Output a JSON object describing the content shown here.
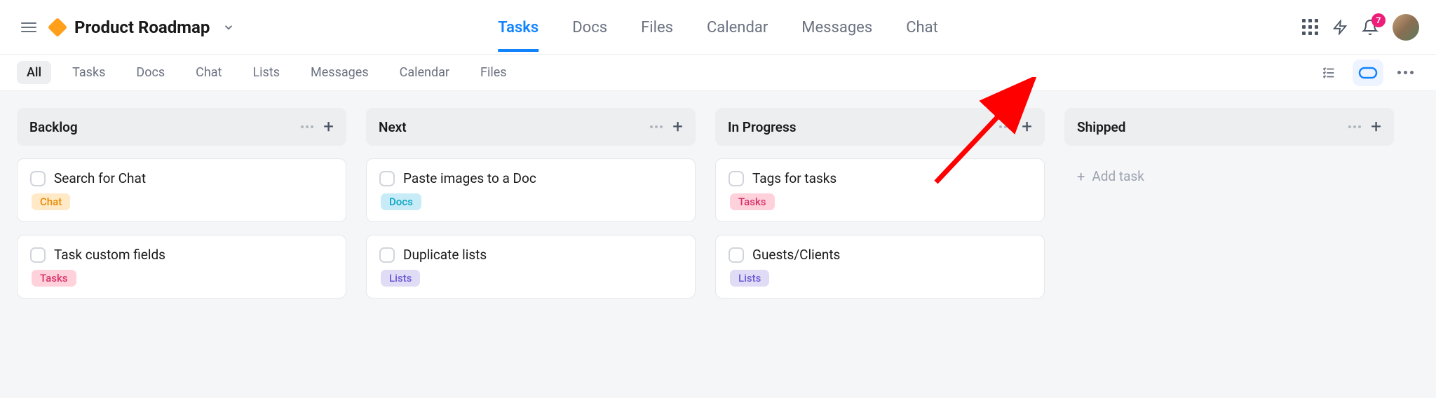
{
  "header": {
    "project_title": "Product Roadmap",
    "nav": [
      "Tasks",
      "Docs",
      "Files",
      "Calendar",
      "Messages",
      "Chat"
    ],
    "active_nav_index": 0,
    "notification_count": "7"
  },
  "filterbar": {
    "chips": [
      "All",
      "Tasks",
      "Docs",
      "Chat",
      "Lists",
      "Messages",
      "Calendar",
      "Files"
    ],
    "active_chip_index": 0
  },
  "board": {
    "columns": [
      {
        "title": "Backlog",
        "cards": [
          {
            "title": "Search for Chat",
            "tag": "Chat",
            "tag_class": "tag-chat"
          },
          {
            "title": "Task custom fields",
            "tag": "Tasks",
            "tag_class": "tag-tasks"
          }
        ]
      },
      {
        "title": "Next",
        "cards": [
          {
            "title": "Paste images to a Doc",
            "tag": "Docs",
            "tag_class": "tag-docs"
          },
          {
            "title": "Duplicate lists",
            "tag": "Lists",
            "tag_class": "tag-lists"
          }
        ]
      },
      {
        "title": "In Progress",
        "cards": [
          {
            "title": "Tags for tasks",
            "tag": "Tasks",
            "tag_class": "tag-tasks"
          },
          {
            "title": "Guests/Clients",
            "tag": "Lists",
            "tag_class": "tag-lists"
          }
        ]
      },
      {
        "title": "Shipped",
        "cards": [],
        "add_task_label": "Add task"
      }
    ]
  }
}
